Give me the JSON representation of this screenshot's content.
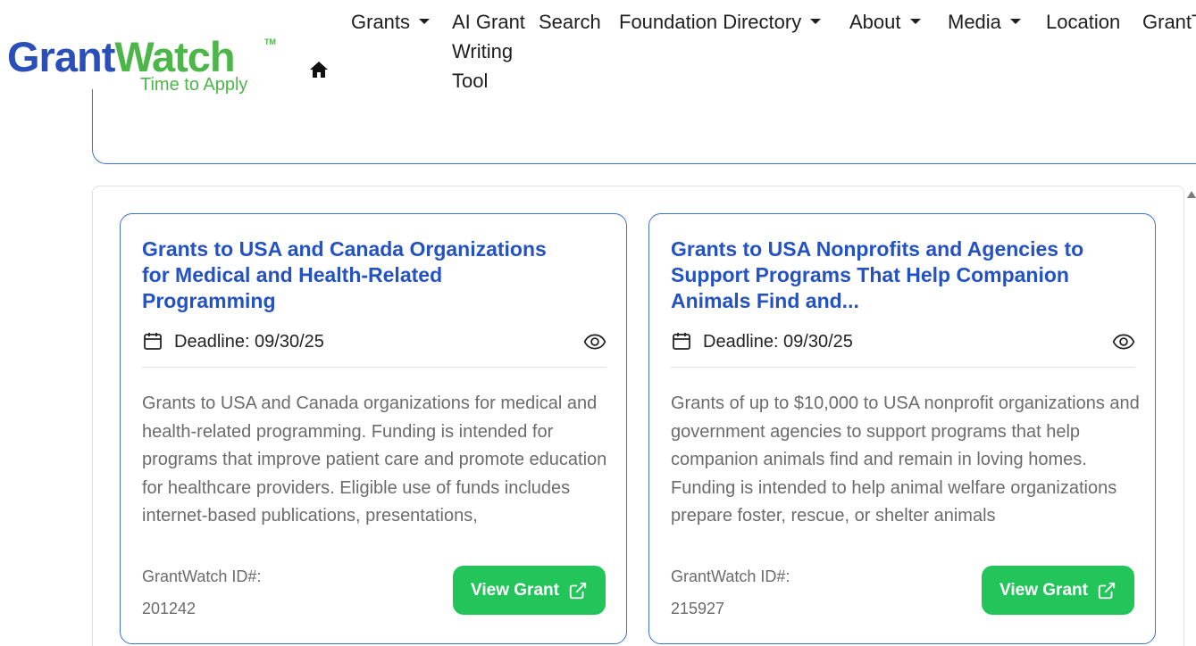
{
  "header": {
    "logo_main_part1": "Grant",
    "logo_main_part2": "Watch",
    "logo_tm": "TM",
    "logo_tagline": "Time to Apply",
    "home_icon": "home-icon",
    "nav": {
      "grants": "Grants",
      "ai_tool": "AI Grant Writing Tool",
      "search": "Search",
      "foundation_directory": "Foundation Directory",
      "about": "About",
      "media": "Media",
      "location": "Location",
      "grantt": "GrantT"
    }
  },
  "colors": {
    "brand_blue": "#2b4fb8",
    "brand_green": "#4db649",
    "title_blue": "#2452c2",
    "card_border": "#3a6fd6",
    "button_green": "#23c45a"
  },
  "cards": [
    {
      "title": "Grants to USA and Canada Organizations for Medical and Health-Related Programming",
      "deadline": "Deadline: 09/30/25",
      "description": "Grants to USA and Canada organizations for medical and health-related programming. Funding is intended for programs that improve patient care and promote education for healthcare providers. Eligible use of funds includes internet-based publications, presentations,",
      "id_label": "GrantWatch ID#:",
      "id_value": "201242",
      "button_label": "View Grant"
    },
    {
      "title": "Grants to USA Nonprofits and Agencies to Support Programs That Help Companion Animals Find and...",
      "deadline": "Deadline: 09/30/25",
      "description": "Grants of up to $10,000 to USA nonprofit organizations and government agencies to support programs that help companion animals find and remain in loving homes. Funding is intended to help animal welfare organizations prepare foster, rescue, or shelter animals",
      "id_label": "GrantWatch ID#:",
      "id_value": "215927",
      "button_label": "View Grant"
    }
  ]
}
